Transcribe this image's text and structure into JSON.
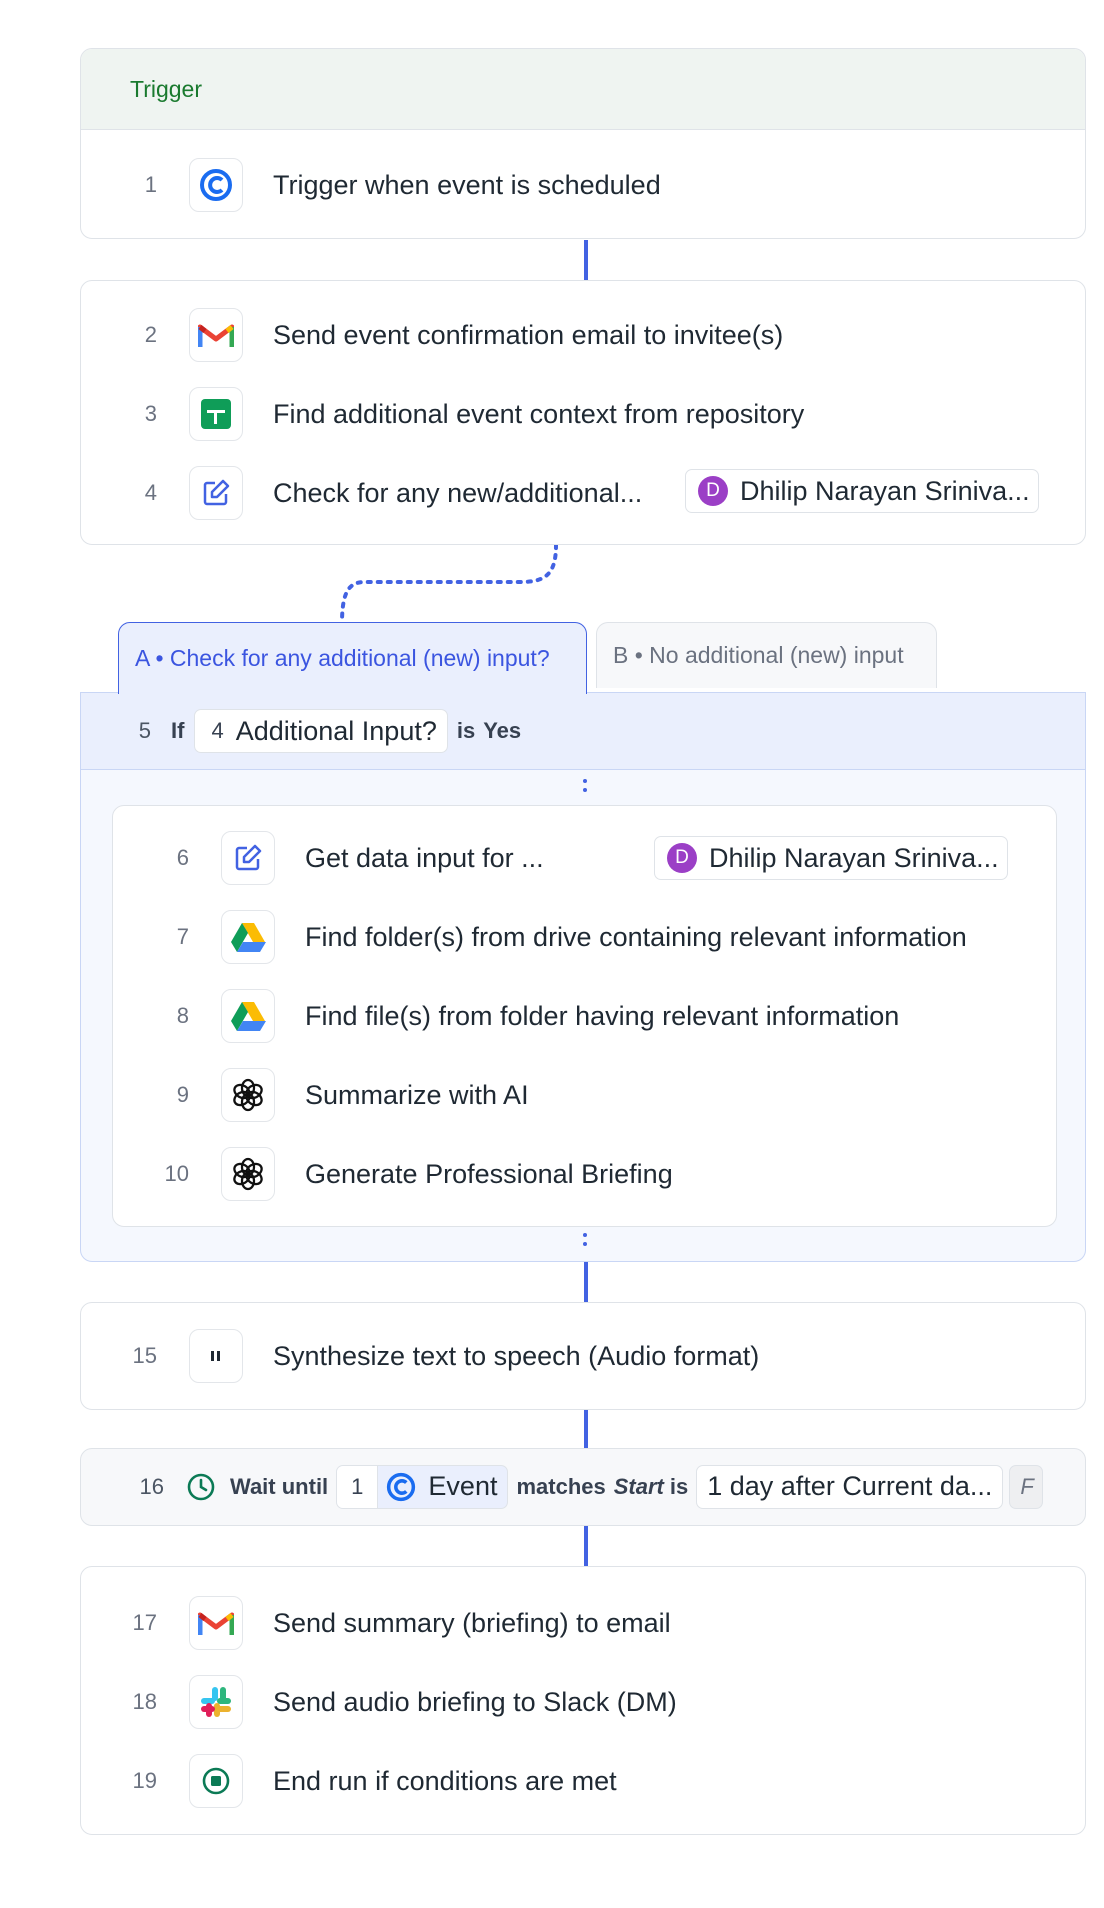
{
  "trigger": {
    "header": "Trigger",
    "step": {
      "num": "1",
      "label": "Trigger when event is scheduled",
      "icon": "calendly-icon"
    }
  },
  "group1": [
    {
      "num": "2",
      "label": "Send event confirmation email to invitee(s)",
      "icon": "gmail-icon"
    },
    {
      "num": "3",
      "label": "Find additional event context from repository",
      "icon": "google-sheets-icon"
    },
    {
      "num": "4",
      "label": "Check for any new/additional...",
      "icon": "edit-form-icon",
      "assignee": {
        "initial": "D",
        "name": "Dhilip Narayan Sriniva..."
      }
    }
  ],
  "branches": {
    "tab_a": "A • Check for any additional (new) input?",
    "tab_b": "B • No additional (new) input",
    "condition": {
      "num": "5",
      "if": "If",
      "ref_num": "4",
      "ref_label": "Additional Input?",
      "is": "is",
      "value": "Yes"
    }
  },
  "branch_a_steps": [
    {
      "num": "6",
      "label": "Get data input for ...",
      "icon": "edit-form-icon",
      "assignee": {
        "initial": "D",
        "name": "Dhilip Narayan Sriniva..."
      }
    },
    {
      "num": "7",
      "label": "Find folder(s) from drive containing relevant information",
      "icon": "google-drive-icon"
    },
    {
      "num": "8",
      "label": "Find file(s) from folder having relevant information",
      "icon": "google-drive-icon"
    },
    {
      "num": "9",
      "label": "Summarize with AI",
      "icon": "openai-icon"
    },
    {
      "num": "10",
      "label": "Generate Professional Briefing",
      "icon": "openai-icon"
    }
  ],
  "step15": {
    "num": "15",
    "label": "Synthesize text to speech (Audio format)",
    "icon": "pause-icon"
  },
  "wait": {
    "num": "16",
    "wait_until": "Wait until",
    "ref_num": "1",
    "ref_label": "Event",
    "matches": "matches",
    "field": "Start",
    "is": "is",
    "value": "1 day after Current da...",
    "overflow": "F"
  },
  "final_group": [
    {
      "num": "17",
      "label": "Send summary (briefing) to email",
      "icon": "gmail-icon"
    },
    {
      "num": "18",
      "label": "Send audio briefing to Slack (DM)",
      "icon": "slack-icon"
    },
    {
      "num": "19",
      "label": "End run if conditions are met",
      "icon": "stop-icon"
    }
  ],
  "colors": {
    "accent": "#4262e2",
    "trigger_green": "#1a7a2f",
    "branch_bg": "#eaeffd",
    "avatar": "#9b3fc6"
  }
}
